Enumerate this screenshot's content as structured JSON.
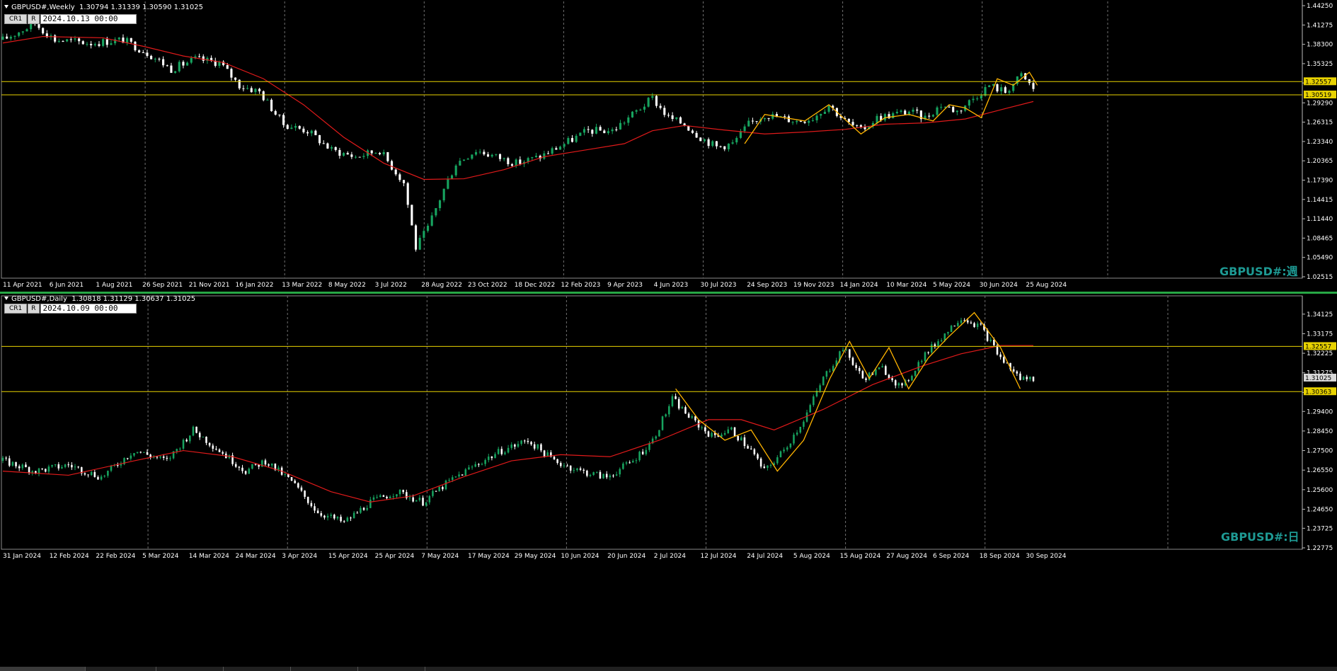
{
  "colors": {
    "bull": "#17a35f",
    "bear": "#ffffff",
    "ma": "#e01a1a",
    "zigzag": "#ffb400",
    "level": "#e8d200",
    "grid": "#707070",
    "axis": "#ffffff",
    "watermark": "#1e9a94"
  },
  "weekly": {
    "header": "GBPUSD#,Weekly  1.30794 1.31339 1.30590 1.31025",
    "cr_label": "CR1",
    "r_label": "R",
    "date_input": "2024.10.13 00:00",
    "watermark": "GBPUSD#:週",
    "chart_data": {
      "type": "candlestick",
      "timeframe": "weekly",
      "x_labels": [
        "11 Apr 2021",
        "6 Jun 2021",
        "1 Aug 2021",
        "26 Sep 2021",
        "21 Nov 2021",
        "16 Jan 2022",
        "13 Mar 2022",
        "8 May 2022",
        "3 Jul 2022",
        "28 Aug 2022",
        "23 Oct 2022",
        "18 Dec 2022",
        "12 Feb 2023",
        "9 Apr 2023",
        "4 Jun 2023",
        "30 Jul 2023",
        "24 Sep 2023",
        "19 Nov 2023",
        "14 Jan 2024",
        "10 Mar 2024",
        "5 May 2024",
        "30 Jun 2024",
        "25 Aug 2024"
      ],
      "y_ticks": [
        "1.44250",
        "1.41275",
        "1.38300",
        "1.35325",
        "1.32350",
        "1.29290",
        "1.26315",
        "1.23340",
        "1.20365",
        "1.17390",
        "1.14415",
        "1.11440",
        "1.08465",
        "1.05490",
        "1.02515"
      ],
      "ylim": [
        1.02515,
        1.4425
      ],
      "levels": [
        {
          "value": 1.32557,
          "label": "1.32557"
        },
        {
          "value": 1.30519,
          "label": "1.30519"
        }
      ],
      "close_path": [
        [
          0,
          1.39
        ],
        [
          8,
          1.415
        ],
        [
          13,
          1.39
        ],
        [
          22,
          1.385
        ],
        [
          30,
          1.39
        ],
        [
          36,
          1.37
        ],
        [
          42,
          1.345
        ],
        [
          48,
          1.36
        ],
        [
          54,
          1.355
        ],
        [
          59,
          1.32
        ],
        [
          64,
          1.31
        ],
        [
          70,
          1.26
        ],
        [
          76,
          1.25
        ],
        [
          82,
          1.22
        ],
        [
          88,
          1.21
        ],
        [
          94,
          1.22
        ],
        [
          100,
          1.17
        ],
        [
          103,
          1.07
        ],
        [
          106,
          1.1
        ],
        [
          110,
          1.16
        ],
        [
          113,
          1.2
        ],
        [
          118,
          1.22
        ],
        [
          123,
          1.21
        ],
        [
          128,
          1.2
        ],
        [
          134,
          1.21
        ],
        [
          140,
          1.23
        ],
        [
          146,
          1.25
        ],
        [
          152,
          1.25
        ],
        [
          158,
          1.28
        ],
        [
          162,
          1.3
        ],
        [
          166,
          1.27
        ],
        [
          170,
          1.26
        ],
        [
          174,
          1.24
        ],
        [
          178,
          1.225
        ],
        [
          182,
          1.23
        ],
        [
          186,
          1.26
        ],
        [
          190,
          1.275
        ],
        [
          194,
          1.27
        ],
        [
          198,
          1.265
        ],
        [
          202,
          1.27
        ],
        [
          206,
          1.29
        ],
        [
          210,
          1.265
        ],
        [
          214,
          1.25
        ],
        [
          218,
          1.27
        ],
        [
          222,
          1.275
        ],
        [
          226,
          1.28
        ],
        [
          230,
          1.27
        ],
        [
          234,
          1.29
        ],
        [
          238,
          1.28
        ],
        [
          242,
          1.3
        ],
        [
          246,
          1.32
        ],
        [
          250,
          1.31
        ],
        [
          254,
          1.335
        ],
        [
          257,
          1.315
        ]
      ],
      "ma_path": [
        [
          0,
          1.385
        ],
        [
          10,
          1.395
        ],
        [
          25,
          1.393
        ],
        [
          35,
          1.38
        ],
        [
          45,
          1.365
        ],
        [
          55,
          1.355
        ],
        [
          65,
          1.33
        ],
        [
          75,
          1.29
        ],
        [
          85,
          1.24
        ],
        [
          95,
          1.2
        ],
        [
          105,
          1.175
        ],
        [
          115,
          1.176
        ],
        [
          125,
          1.19
        ],
        [
          135,
          1.21
        ],
        [
          145,
          1.22
        ],
        [
          155,
          1.23
        ],
        [
          162,
          1.25
        ],
        [
          170,
          1.258
        ],
        [
          180,
          1.251
        ],
        [
          190,
          1.245
        ],
        [
          200,
          1.248
        ],
        [
          210,
          1.252
        ],
        [
          220,
          1.26
        ],
        [
          230,
          1.262
        ],
        [
          240,
          1.268
        ],
        [
          250,
          1.284
        ],
        [
          257,
          1.295
        ]
      ],
      "zigzag_path": [
        [
          185,
          1.23
        ],
        [
          190,
          1.275
        ],
        [
          200,
          1.265
        ],
        [
          206,
          1.29
        ],
        [
          214,
          1.245
        ],
        [
          220,
          1.27
        ],
        [
          226,
          1.275
        ],
        [
          232,
          1.265
        ],
        [
          236,
          1.29
        ],
        [
          240,
          1.285
        ],
        [
          244,
          1.27
        ],
        [
          248,
          1.33
        ],
        [
          252,
          1.32
        ],
        [
          256,
          1.34
        ],
        [
          258,
          1.32
        ]
      ]
    }
  },
  "daily": {
    "header": "GBPUSD#,Daily  1.30818 1.31129 1.30637 1.31025",
    "cr_label": "CR1",
    "r_label": "R",
    "date_input": "2024.10.09 00:00",
    "watermark": "GBPUSD#:日",
    "chart_data": {
      "type": "candlestick",
      "timeframe": "daily",
      "x_labels": [
        "31 Jan 2024",
        "12 Feb 2024",
        "22 Feb 2024",
        "5 Mar 2024",
        "14 Mar 2024",
        "24 Mar 2024",
        "3 Apr 2024",
        "15 Apr 2024",
        "25 Apr 2024",
        "7 May 2024",
        "17 May 2024",
        "29 May 2024",
        "10 Jun 2024",
        "20 Jun 2024",
        "2 Jul 2024",
        "12 Jul 2024",
        "24 Jul 2024",
        "5 Aug 2024",
        "15 Aug 2024",
        "27 Aug 2024",
        "6 Sep 2024",
        "18 Sep 2024",
        "30 Sep 2024"
      ],
      "y_ticks": [
        "1.34125",
        "1.33175",
        "1.32225",
        "1.31275",
        "1.30325",
        "1.29400",
        "1.28450",
        "1.27500",
        "1.26550",
        "1.25600",
        "1.24650",
        "1.23725",
        "1.22775"
      ],
      "ylim": [
        1.22775,
        1.346
      ],
      "levels": [
        {
          "value": 1.32557,
          "label": "1.32557"
        },
        {
          "value": 1.30363,
          "label": "1.30363"
        }
      ],
      "current_price": "1.31025",
      "close_path": [
        [
          0,
          1.27
        ],
        [
          10,
          1.265
        ],
        [
          20,
          1.268
        ],
        [
          30,
          1.262
        ],
        [
          40,
          1.275
        ],
        [
          50,
          1.27
        ],
        [
          58,
          1.285
        ],
        [
          66,
          1.275
        ],
        [
          74,
          1.265
        ],
        [
          80,
          1.27
        ],
        [
          88,
          1.26
        ],
        [
          96,
          1.245
        ],
        [
          104,
          1.24
        ],
        [
          112,
          1.25
        ],
        [
          120,
          1.255
        ],
        [
          128,
          1.25
        ],
        [
          136,
          1.26
        ],
        [
          144,
          1.268
        ],
        [
          152,
          1.275
        ],
        [
          160,
          1.28
        ],
        [
          168,
          1.27
        ],
        [
          176,
          1.265
        ],
        [
          184,
          1.262
        ],
        [
          192,
          1.27
        ],
        [
          198,
          1.28
        ],
        [
          204,
          1.3
        ],
        [
          210,
          1.29
        ],
        [
          216,
          1.282
        ],
        [
          222,
          1.285
        ],
        [
          228,
          1.275
        ],
        [
          232,
          1.265
        ],
        [
          238,
          1.275
        ],
        [
          244,
          1.29
        ],
        [
          250,
          1.31
        ],
        [
          256,
          1.325
        ],
        [
          262,
          1.31
        ],
        [
          268,
          1.315
        ],
        [
          274,
          1.305
        ],
        [
          280,
          1.32
        ],
        [
          286,
          1.33
        ],
        [
          292,
          1.34
        ],
        [
          298,
          1.335
        ],
        [
          304,
          1.32
        ],
        [
          310,
          1.31
        ],
        [
          314,
          1.31
        ]
      ],
      "ma_path": [
        [
          0,
          1.265
        ],
        [
          20,
          1.263
        ],
        [
          40,
          1.27
        ],
        [
          55,
          1.275
        ],
        [
          70,
          1.272
        ],
        [
          85,
          1.265
        ],
        [
          100,
          1.255
        ],
        [
          112,
          1.25
        ],
        [
          125,
          1.253
        ],
        [
          140,
          1.262
        ],
        [
          155,
          1.27
        ],
        [
          170,
          1.273
        ],
        [
          185,
          1.272
        ],
        [
          200,
          1.28
        ],
        [
          215,
          1.29
        ],
        [
          225,
          1.29
        ],
        [
          235,
          1.285
        ],
        [
          250,
          1.295
        ],
        [
          265,
          1.307
        ],
        [
          280,
          1.316
        ],
        [
          292,
          1.322
        ],
        [
          304,
          1.326
        ],
        [
          314,
          1.326
        ]
      ],
      "zigzag_path": [
        [
          205,
          1.305
        ],
        [
          212,
          1.29
        ],
        [
          220,
          1.28
        ],
        [
          228,
          1.285
        ],
        [
          236,
          1.265
        ],
        [
          244,
          1.28
        ],
        [
          252,
          1.31
        ],
        [
          258,
          1.328
        ],
        [
          264,
          1.31
        ],
        [
          270,
          1.325
        ],
        [
          276,
          1.305
        ],
        [
          282,
          1.32
        ],
        [
          288,
          1.33
        ],
        [
          296,
          1.342
        ],
        [
          304,
          1.325
        ],
        [
          310,
          1.305
        ]
      ]
    }
  }
}
